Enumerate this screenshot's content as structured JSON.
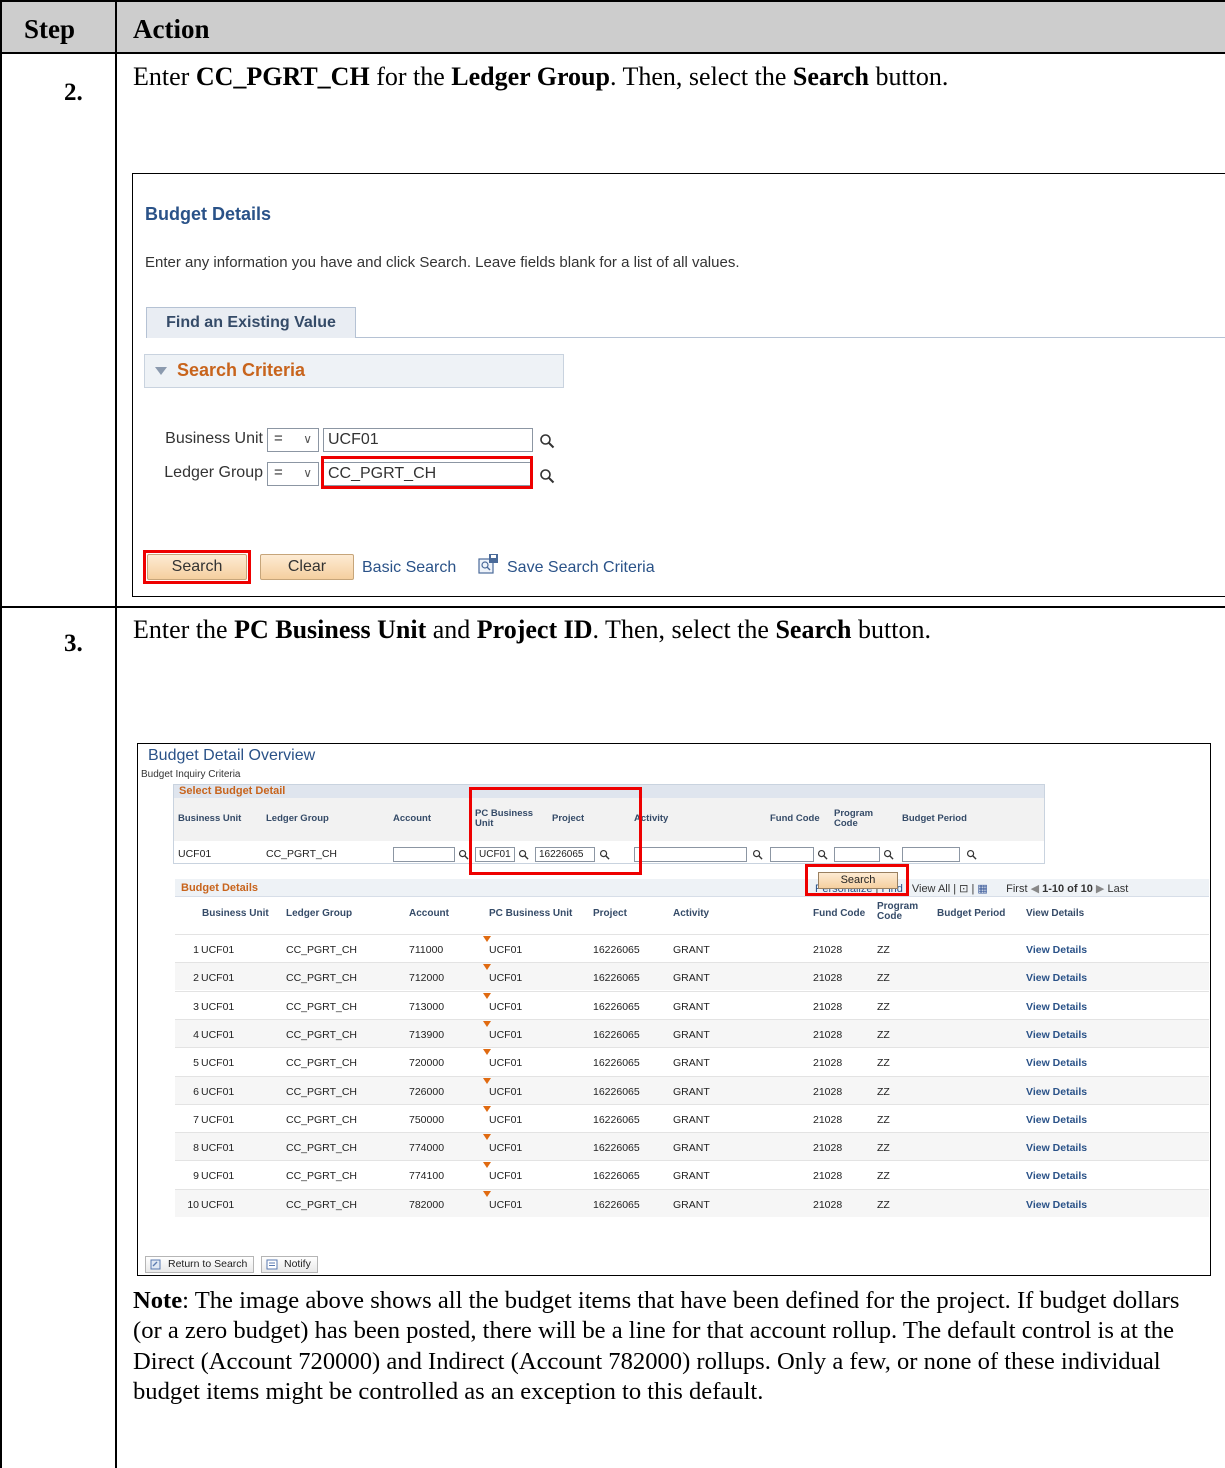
{
  "header": {
    "step": "Step",
    "action": "Action"
  },
  "steps": [
    {
      "number": "2.",
      "instruction": [
        {
          "t": "Enter ",
          "b": false
        },
        {
          "t": "CC_PGRT_CH",
          "b": true
        },
        {
          "t": " for the ",
          "b": false
        },
        {
          "t": "Ledger Group",
          "b": true
        },
        {
          "t": ".  Then, select the ",
          "b": false
        },
        {
          "t": "Search",
          "b": true
        },
        {
          "t": " button.",
          "b": false
        }
      ]
    },
    {
      "number": "3.",
      "instruction": [
        {
          "t": "Enter the ",
          "b": false
        },
        {
          "t": "PC Business Unit",
          "b": true
        },
        {
          "t": " and ",
          "b": false
        },
        {
          "t": "Project ID",
          "b": true
        },
        {
          "t": ". Then, select the ",
          "b": false
        },
        {
          "t": "Search",
          "b": true
        },
        {
          "t": " button.",
          "b": false
        }
      ]
    }
  ],
  "shot1": {
    "title": "Budget Details",
    "instructions": "Enter any information you have and click Search. Leave fields blank for a list of all values.",
    "tab": "Find an Existing Value",
    "criteria_label": "Search Criteria",
    "fields": [
      {
        "label": "Business Unit",
        "operator": "=",
        "value": "UCF01"
      },
      {
        "label": "Ledger Group",
        "operator": "=",
        "value": "CC_PGRT_CH"
      }
    ],
    "search_button": "Search",
    "clear_button": "Clear",
    "basic_search": "Basic Search",
    "save_criteria": "Save Search Criteria"
  },
  "shot2": {
    "title": "Budget Detail Overview",
    "subtitle": "Budget Inquiry Criteria",
    "select_header": "Select Budget Detail",
    "select_cols": [
      "Business Unit",
      "Ledger Group",
      "Account",
      "PC Business Unit",
      "Project",
      "Activity",
      "Fund Code",
      "Program Code",
      "Budget Period"
    ],
    "select_values": {
      "business_unit": "UCF01",
      "ledger_group": "CC_PGRT_CH",
      "pc_business_unit": "UCF01",
      "project": "16226065"
    },
    "search_button": "Search",
    "grid_title": "Budget Details",
    "nav": {
      "personalize": "Personalize",
      "find": "Find",
      "view_all": "View All",
      "first": "First",
      "range": "1-10 of 10",
      "last": "Last"
    },
    "grid_cols": [
      "Business Unit",
      "Ledger Group",
      "Account",
      "PC Business Unit",
      "Project",
      "Activity",
      "Fund Code",
      "Program Code",
      "Budget Period",
      "View Details"
    ],
    "rows": [
      [
        "1",
        "UCF01",
        "CC_PGRT_CH",
        "711000",
        "UCF01",
        "16226065",
        "GRANT",
        "21028",
        "ZZ",
        "",
        "View Details"
      ],
      [
        "2",
        "UCF01",
        "CC_PGRT_CH",
        "712000",
        "UCF01",
        "16226065",
        "GRANT",
        "21028",
        "ZZ",
        "",
        "View Details"
      ],
      [
        "3",
        "UCF01",
        "CC_PGRT_CH",
        "713000",
        "UCF01",
        "16226065",
        "GRANT",
        "21028",
        "ZZ",
        "",
        "View Details"
      ],
      [
        "4",
        "UCF01",
        "CC_PGRT_CH",
        "713900",
        "UCF01",
        "16226065",
        "GRANT",
        "21028",
        "ZZ",
        "",
        "View Details"
      ],
      [
        "5",
        "UCF01",
        "CC_PGRT_CH",
        "720000",
        "UCF01",
        "16226065",
        "GRANT",
        "21028",
        "ZZ",
        "",
        "View Details"
      ],
      [
        "6",
        "UCF01",
        "CC_PGRT_CH",
        "726000",
        "UCF01",
        "16226065",
        "GRANT",
        "21028",
        "ZZ",
        "",
        "View Details"
      ],
      [
        "7",
        "UCF01",
        "CC_PGRT_CH",
        "750000",
        "UCF01",
        "16226065",
        "GRANT",
        "21028",
        "ZZ",
        "",
        "View Details"
      ],
      [
        "8",
        "UCF01",
        "CC_PGRT_CH",
        "774000",
        "UCF01",
        "16226065",
        "GRANT",
        "21028",
        "ZZ",
        "",
        "View Details"
      ],
      [
        "9",
        "UCF01",
        "CC_PGRT_CH",
        "774100",
        "UCF01",
        "16226065",
        "GRANT",
        "21028",
        "ZZ",
        "",
        "View Details"
      ],
      [
        "10",
        "UCF01",
        "CC_PGRT_CH",
        "782000",
        "UCF01",
        "16226065",
        "GRANT",
        "21028",
        "ZZ",
        "",
        "View Details"
      ]
    ],
    "return_button": "Return to Search",
    "notify_button": "Notify"
  },
  "note": {
    "label": "Note",
    "text": ": The image above shows all the budget items that have been defined for the project.  If budget dollars (or a zero budget) has been posted, there will be a line for that account rollup.  The default control is at the Direct (Account 720000) and Indirect (Account 782000) rollups. Only a few, or none of these individual budget items might be controlled as an exception to this default."
  },
  "colors": {
    "accent": "#2a5288",
    "criteria": "#c8641c",
    "highlight": "#e00000",
    "header_bg": "#cdcdcd"
  }
}
